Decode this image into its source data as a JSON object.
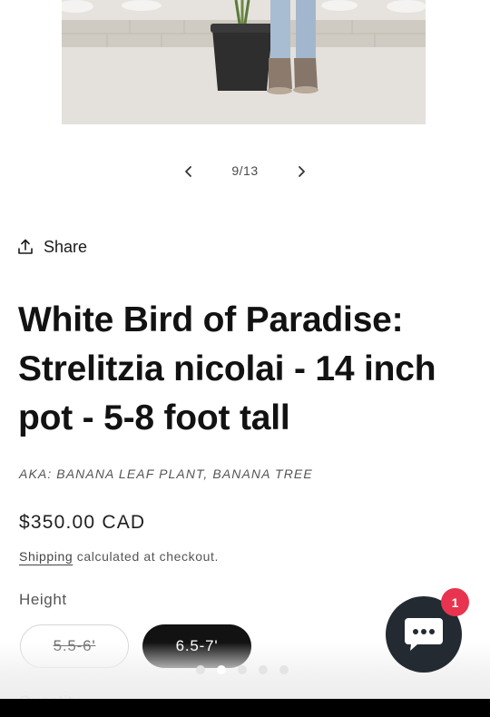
{
  "gallery": {
    "counter": "9/13",
    "prev_icon": "chevron-left-icon",
    "next_icon": "chevron-right-icon"
  },
  "share": {
    "label": "Share",
    "icon": "share-icon"
  },
  "product": {
    "title": "White Bird of Paradise: Strelitzia nicolai - 14 inch pot - 5-8 foot tall",
    "aka": "AKA: BANANA LEAF PLANT, BANANA TREE",
    "price": "$350.00 CAD",
    "shipping_link": "Shipping",
    "shipping_text": " calculated at checkout."
  },
  "height": {
    "label": "Height",
    "options": [
      {
        "label": "5.5-6'",
        "available": false,
        "selected": false
      },
      {
        "label": "6.5-7'",
        "available": true,
        "selected": true
      }
    ]
  },
  "quantity": {
    "label": "Quantity"
  },
  "chat": {
    "icon": "chat-bubble-icon",
    "badge": "1",
    "color": "#232a31",
    "badge_color": "#e8344e"
  },
  "colors": {
    "text": "#121212",
    "selected_variant_bg": "#121212"
  }
}
